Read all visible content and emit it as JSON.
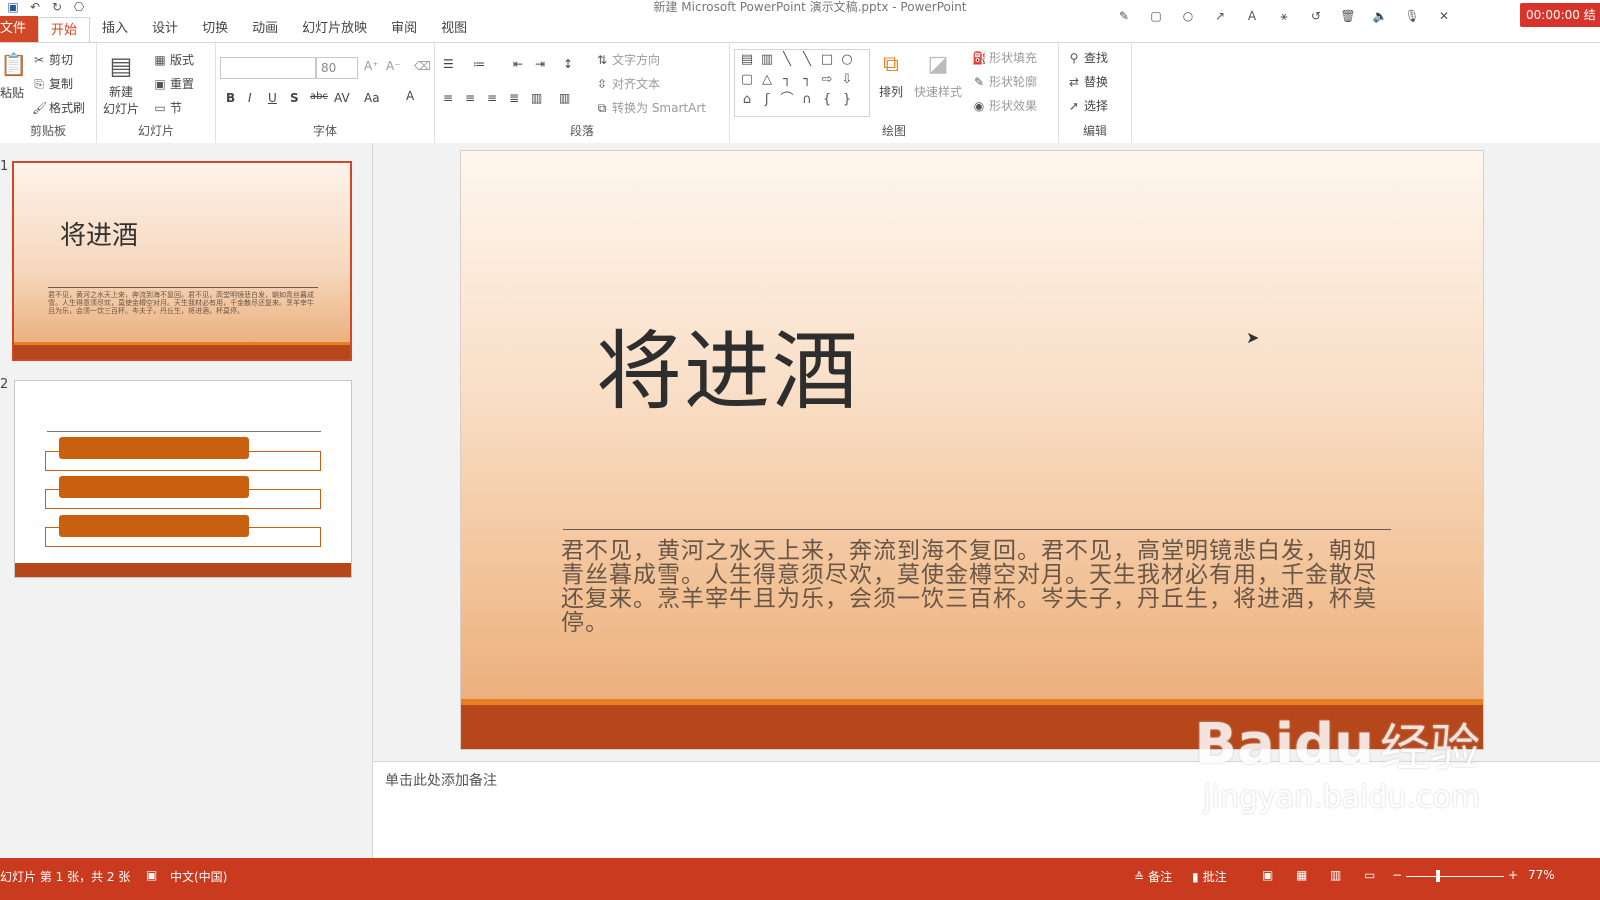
{
  "app": {
    "doc_title": "新建 Microsoft PowerPoint 演示文稿.pptx - PowerPoint",
    "recorder_time": "00:00:00 结"
  },
  "tabs": [
    {
      "label": "文件"
    },
    {
      "label": "开始"
    },
    {
      "label": "插入"
    },
    {
      "label": "设计"
    },
    {
      "label": "切换"
    },
    {
      "label": "动画"
    },
    {
      "label": "幻灯片放映"
    },
    {
      "label": "审阅"
    },
    {
      "label": "视图"
    }
  ],
  "ribbon": {
    "clipboard": {
      "paste": "粘贴",
      "cut": "剪切",
      "copy": "复制",
      "format_painter": "格式刷",
      "label": "剪贴板"
    },
    "slides": {
      "new_slide": "新建",
      "new_slide2": "幻灯片",
      "layout": "版式",
      "reset": "重置",
      "section": "节",
      "label": "幻灯片"
    },
    "font": {
      "font_name": "",
      "font_size": "80",
      "label": "字体"
    },
    "paragraph": {
      "text_direction": "文字方向",
      "align_text": "对齐文本",
      "convert_smartart": "转换为 SmartArt",
      "label": "段落"
    },
    "drawing": {
      "arrange": "排列",
      "quick_styles": "快速样式",
      "shape_fill": "形状填充",
      "shape_outline": "形状轮廓",
      "shape_effects": "形状效果",
      "label": "绘图"
    },
    "editing": {
      "find": "查找",
      "replace": "替换",
      "select": "选择",
      "label": "编辑"
    }
  },
  "thumbnails": [
    {
      "num": "1",
      "title": "将进酒",
      "body": "君不见，黄河之水天上来，奔流到海不复回。君不见，高堂明镜悲白发，朝如青丝暮成雪。人生得意须尽欢，莫使金樽空对月。天生我材必有用，千金散尽还复来。烹羊宰牛且为乐，会须一饮三百杯。岑夫子，丹丘生，将进酒，杯莫停。"
    },
    {
      "num": "2"
    }
  ],
  "slide": {
    "title": "将进酒",
    "body": "君不见，黄河之水天上来，奔流到海不复回。君不见，高堂明镜悲白发，朝如青丝暮成雪。人生得意须尽欢，莫使金樽空对月。天生我材必有用，千金散尽还复来。烹羊宰牛且为乐，会须一饮三百杯。岑夫子，丹丘生，将进酒，杯莫停。"
  },
  "notes": {
    "placeholder": "单击此处添加备注"
  },
  "status": {
    "slide_info": "幻灯片 第 1 张，共 2 张",
    "language": "中文(中国)",
    "notes": "备注",
    "comments": "批注",
    "zoom": "77%"
  },
  "watermark": {
    "brand": "Baidu",
    "brand_cn": "经验",
    "url": "jingyan.baidu.com"
  },
  "colors": {
    "accent": "#d24726",
    "status_bar": "#c93a1f",
    "slide_bar": "#b6471a",
    "slide_bar_top": "#e57f26",
    "thumb_bar": "#c8600f"
  }
}
